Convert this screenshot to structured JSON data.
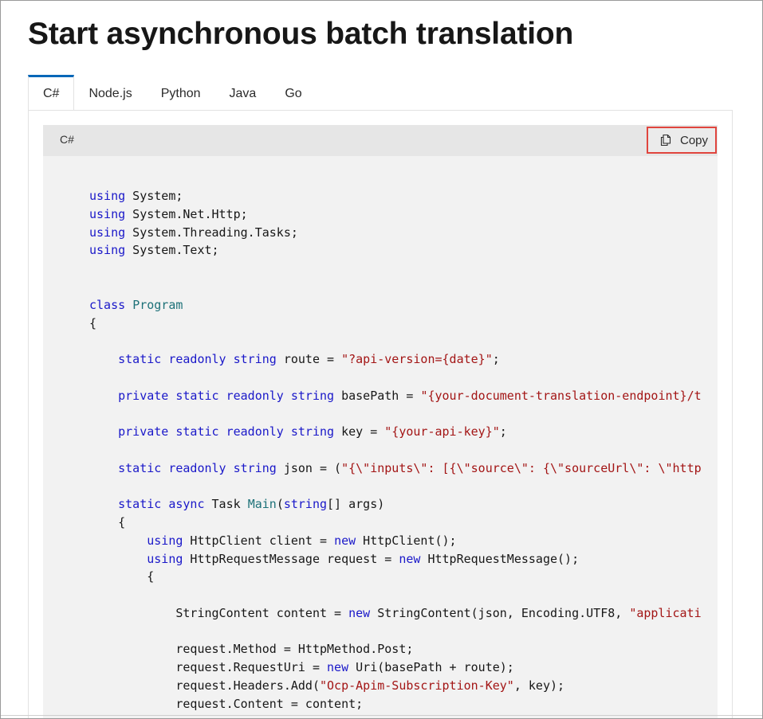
{
  "page_title": "Start asynchronous batch translation",
  "tabs": [
    {
      "label": "C#",
      "active": true
    },
    {
      "label": "Node.js",
      "active": false
    },
    {
      "label": "Python",
      "active": false
    },
    {
      "label": "Java",
      "active": false
    },
    {
      "label": "Go",
      "active": false
    }
  ],
  "code_block": {
    "language_label": "C#",
    "copy_label": "Copy",
    "copy_icon": "copy-icon",
    "highlight_color": "#e0453e",
    "colors": {
      "keyword": "#1a18c9",
      "type": "#1d7178",
      "string": "#a31515",
      "plain": "#171717"
    },
    "lines": [
      [
        [
          "k",
          "using"
        ],
        [
          "p",
          " System;"
        ]
      ],
      [
        [
          "k",
          "using"
        ],
        [
          "p",
          " System.Net.Http;"
        ]
      ],
      [
        [
          "k",
          "using"
        ],
        [
          "p",
          " System.Threading.Tasks;"
        ]
      ],
      [
        [
          "k",
          "using"
        ],
        [
          "p",
          " System.Text;"
        ]
      ],
      [
        [
          "k",
          "class"
        ],
        [
          "p",
          " "
        ],
        [
          "t",
          "Program"
        ]
      ],
      [
        [
          "p",
          "{"
        ]
      ],
      [
        [
          "p",
          "    "
        ],
        [
          "k",
          "static"
        ],
        [
          "p",
          " "
        ],
        [
          "k",
          "readonly"
        ],
        [
          "p",
          " "
        ],
        [
          "k",
          "string"
        ],
        [
          "p",
          " route = "
        ],
        [
          "s",
          "\"?api-version={date}\""
        ],
        [
          "p",
          ";"
        ]
      ],
      [
        [
          "p",
          "    "
        ],
        [
          "k",
          "private"
        ],
        [
          "p",
          " "
        ],
        [
          "k",
          "static"
        ],
        [
          "p",
          " "
        ],
        [
          "k",
          "readonly"
        ],
        [
          "p",
          " "
        ],
        [
          "k",
          "string"
        ],
        [
          "p",
          " basePath = "
        ],
        [
          "s",
          "\"{your-document-translation-endpoint}/t"
        ]
      ],
      [
        [
          "p",
          "    "
        ],
        [
          "k",
          "private"
        ],
        [
          "p",
          " "
        ],
        [
          "k",
          "static"
        ],
        [
          "p",
          " "
        ],
        [
          "k",
          "readonly"
        ],
        [
          "p",
          " "
        ],
        [
          "k",
          "string"
        ],
        [
          "p",
          " key = "
        ],
        [
          "s",
          "\"{your-api-key}\""
        ],
        [
          "p",
          ";"
        ]
      ],
      [
        [
          "p",
          "    "
        ],
        [
          "k",
          "static"
        ],
        [
          "p",
          " "
        ],
        [
          "k",
          "readonly"
        ],
        [
          "p",
          " "
        ],
        [
          "k",
          "string"
        ],
        [
          "p",
          " json = ("
        ],
        [
          "s",
          "\"{\\\"inputs\\\": [{\\\"source\\\": {\\\"sourceUrl\\\": \\\"http"
        ]
      ],
      [
        [
          "p",
          "    "
        ],
        [
          "k",
          "static"
        ],
        [
          "p",
          " "
        ],
        [
          "k",
          "async"
        ],
        [
          "p",
          " Task "
        ],
        [
          "t",
          "Main"
        ],
        [
          "p",
          "("
        ],
        [
          "k",
          "string"
        ],
        [
          "p",
          "[] args)"
        ]
      ],
      [
        [
          "p",
          "    {"
        ]
      ],
      [
        [
          "p",
          "        "
        ],
        [
          "k",
          "using"
        ],
        [
          "p",
          " HttpClient client = "
        ],
        [
          "k",
          "new"
        ],
        [
          "p",
          " HttpClient();"
        ]
      ],
      [
        [
          "p",
          "        "
        ],
        [
          "k",
          "using"
        ],
        [
          "p",
          " HttpRequestMessage request = "
        ],
        [
          "k",
          "new"
        ],
        [
          "p",
          " HttpRequestMessage();"
        ]
      ],
      [
        [
          "p",
          "        {"
        ]
      ],
      [
        [
          "p",
          "            StringContent content = "
        ],
        [
          "k",
          "new"
        ],
        [
          "p",
          " StringContent(json, Encoding.UTF8, "
        ],
        [
          "s",
          "\"applicati"
        ]
      ],
      [
        [
          "p",
          "            request.Method = HttpMethod.Post;"
        ]
      ],
      [
        [
          "p",
          "            request.RequestUri = "
        ],
        [
          "k",
          "new"
        ],
        [
          "p",
          " Uri(basePath + route);"
        ]
      ],
      [
        [
          "p",
          "            request.Headers.Add("
        ],
        [
          "s",
          "\"Ocp-Apim-Subscription-Key\""
        ],
        [
          "p",
          ", key);"
        ]
      ],
      [
        [
          "p",
          "            request.Content = content;"
        ]
      ]
    ]
  }
}
